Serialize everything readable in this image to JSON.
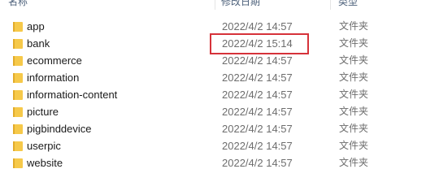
{
  "columns": {
    "name": "名称",
    "date_modified": "修改日期",
    "type": "类型"
  },
  "rows": [
    {
      "name": "app",
      "date": "2022/4/2 14:57",
      "type": "文件夹"
    },
    {
      "name": "bank",
      "date": "2022/4/2 15:14",
      "type": "文件夹"
    },
    {
      "name": "ecommerce",
      "date": "2022/4/2 14:57",
      "type": "文件夹"
    },
    {
      "name": "information",
      "date": "2022/4/2 14:57",
      "type": "文件夹"
    },
    {
      "name": "information-content",
      "date": "2022/4/2 14:57",
      "type": "文件夹"
    },
    {
      "name": "picture",
      "date": "2022/4/2 14:57",
      "type": "文件夹"
    },
    {
      "name": "pigbinddevice",
      "date": "2022/4/2 14:57",
      "type": "文件夹"
    },
    {
      "name": "userpic",
      "date": "2022/4/2 14:57",
      "type": "文件夹"
    },
    {
      "name": "website",
      "date": "2022/4/2 14:57",
      "type": "文件夹"
    }
  ],
  "icons": {
    "row_icon": "folder-icon"
  },
  "colors": {
    "folder": "#f6c94a",
    "highlight": "#d6323a"
  }
}
